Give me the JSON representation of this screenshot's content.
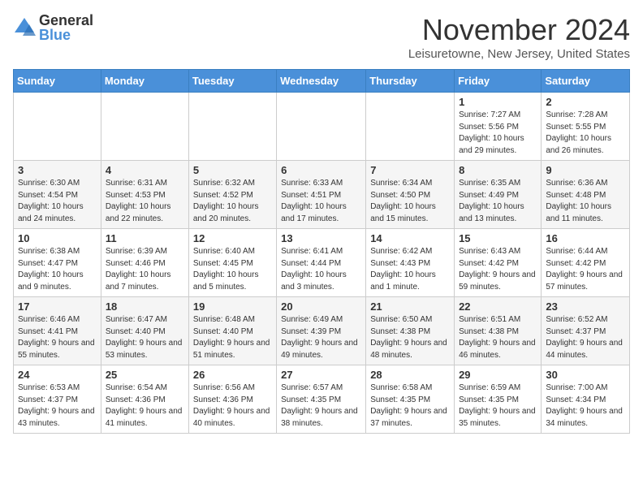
{
  "header": {
    "logo_general": "General",
    "logo_blue": "Blue",
    "month_title": "November 2024",
    "subtitle": "Leisuretowne, New Jersey, United States"
  },
  "days_of_week": [
    "Sunday",
    "Monday",
    "Tuesday",
    "Wednesday",
    "Thursday",
    "Friday",
    "Saturday"
  ],
  "weeks": [
    [
      {
        "day": "",
        "info": ""
      },
      {
        "day": "",
        "info": ""
      },
      {
        "day": "",
        "info": ""
      },
      {
        "day": "",
        "info": ""
      },
      {
        "day": "",
        "info": ""
      },
      {
        "day": "1",
        "info": "Sunrise: 7:27 AM\nSunset: 5:56 PM\nDaylight: 10 hours and 29 minutes."
      },
      {
        "day": "2",
        "info": "Sunrise: 7:28 AM\nSunset: 5:55 PM\nDaylight: 10 hours and 26 minutes."
      }
    ],
    [
      {
        "day": "3",
        "info": "Sunrise: 6:30 AM\nSunset: 4:54 PM\nDaylight: 10 hours and 24 minutes."
      },
      {
        "day": "4",
        "info": "Sunrise: 6:31 AM\nSunset: 4:53 PM\nDaylight: 10 hours and 22 minutes."
      },
      {
        "day": "5",
        "info": "Sunrise: 6:32 AM\nSunset: 4:52 PM\nDaylight: 10 hours and 20 minutes."
      },
      {
        "day": "6",
        "info": "Sunrise: 6:33 AM\nSunset: 4:51 PM\nDaylight: 10 hours and 17 minutes."
      },
      {
        "day": "7",
        "info": "Sunrise: 6:34 AM\nSunset: 4:50 PM\nDaylight: 10 hours and 15 minutes."
      },
      {
        "day": "8",
        "info": "Sunrise: 6:35 AM\nSunset: 4:49 PM\nDaylight: 10 hours and 13 minutes."
      },
      {
        "day": "9",
        "info": "Sunrise: 6:36 AM\nSunset: 4:48 PM\nDaylight: 10 hours and 11 minutes."
      }
    ],
    [
      {
        "day": "10",
        "info": "Sunrise: 6:38 AM\nSunset: 4:47 PM\nDaylight: 10 hours and 9 minutes."
      },
      {
        "day": "11",
        "info": "Sunrise: 6:39 AM\nSunset: 4:46 PM\nDaylight: 10 hours and 7 minutes."
      },
      {
        "day": "12",
        "info": "Sunrise: 6:40 AM\nSunset: 4:45 PM\nDaylight: 10 hours and 5 minutes."
      },
      {
        "day": "13",
        "info": "Sunrise: 6:41 AM\nSunset: 4:44 PM\nDaylight: 10 hours and 3 minutes."
      },
      {
        "day": "14",
        "info": "Sunrise: 6:42 AM\nSunset: 4:43 PM\nDaylight: 10 hours and 1 minute."
      },
      {
        "day": "15",
        "info": "Sunrise: 6:43 AM\nSunset: 4:42 PM\nDaylight: 9 hours and 59 minutes."
      },
      {
        "day": "16",
        "info": "Sunrise: 6:44 AM\nSunset: 4:42 PM\nDaylight: 9 hours and 57 minutes."
      }
    ],
    [
      {
        "day": "17",
        "info": "Sunrise: 6:46 AM\nSunset: 4:41 PM\nDaylight: 9 hours and 55 minutes."
      },
      {
        "day": "18",
        "info": "Sunrise: 6:47 AM\nSunset: 4:40 PM\nDaylight: 9 hours and 53 minutes."
      },
      {
        "day": "19",
        "info": "Sunrise: 6:48 AM\nSunset: 4:40 PM\nDaylight: 9 hours and 51 minutes."
      },
      {
        "day": "20",
        "info": "Sunrise: 6:49 AM\nSunset: 4:39 PM\nDaylight: 9 hours and 49 minutes."
      },
      {
        "day": "21",
        "info": "Sunrise: 6:50 AM\nSunset: 4:38 PM\nDaylight: 9 hours and 48 minutes."
      },
      {
        "day": "22",
        "info": "Sunrise: 6:51 AM\nSunset: 4:38 PM\nDaylight: 9 hours and 46 minutes."
      },
      {
        "day": "23",
        "info": "Sunrise: 6:52 AM\nSunset: 4:37 PM\nDaylight: 9 hours and 44 minutes."
      }
    ],
    [
      {
        "day": "24",
        "info": "Sunrise: 6:53 AM\nSunset: 4:37 PM\nDaylight: 9 hours and 43 minutes."
      },
      {
        "day": "25",
        "info": "Sunrise: 6:54 AM\nSunset: 4:36 PM\nDaylight: 9 hours and 41 minutes."
      },
      {
        "day": "26",
        "info": "Sunrise: 6:56 AM\nSunset: 4:36 PM\nDaylight: 9 hours and 40 minutes."
      },
      {
        "day": "27",
        "info": "Sunrise: 6:57 AM\nSunset: 4:35 PM\nDaylight: 9 hours and 38 minutes."
      },
      {
        "day": "28",
        "info": "Sunrise: 6:58 AM\nSunset: 4:35 PM\nDaylight: 9 hours and 37 minutes."
      },
      {
        "day": "29",
        "info": "Sunrise: 6:59 AM\nSunset: 4:35 PM\nDaylight: 9 hours and 35 minutes."
      },
      {
        "day": "30",
        "info": "Sunrise: 7:00 AM\nSunset: 4:34 PM\nDaylight: 9 hours and 34 minutes."
      }
    ]
  ]
}
